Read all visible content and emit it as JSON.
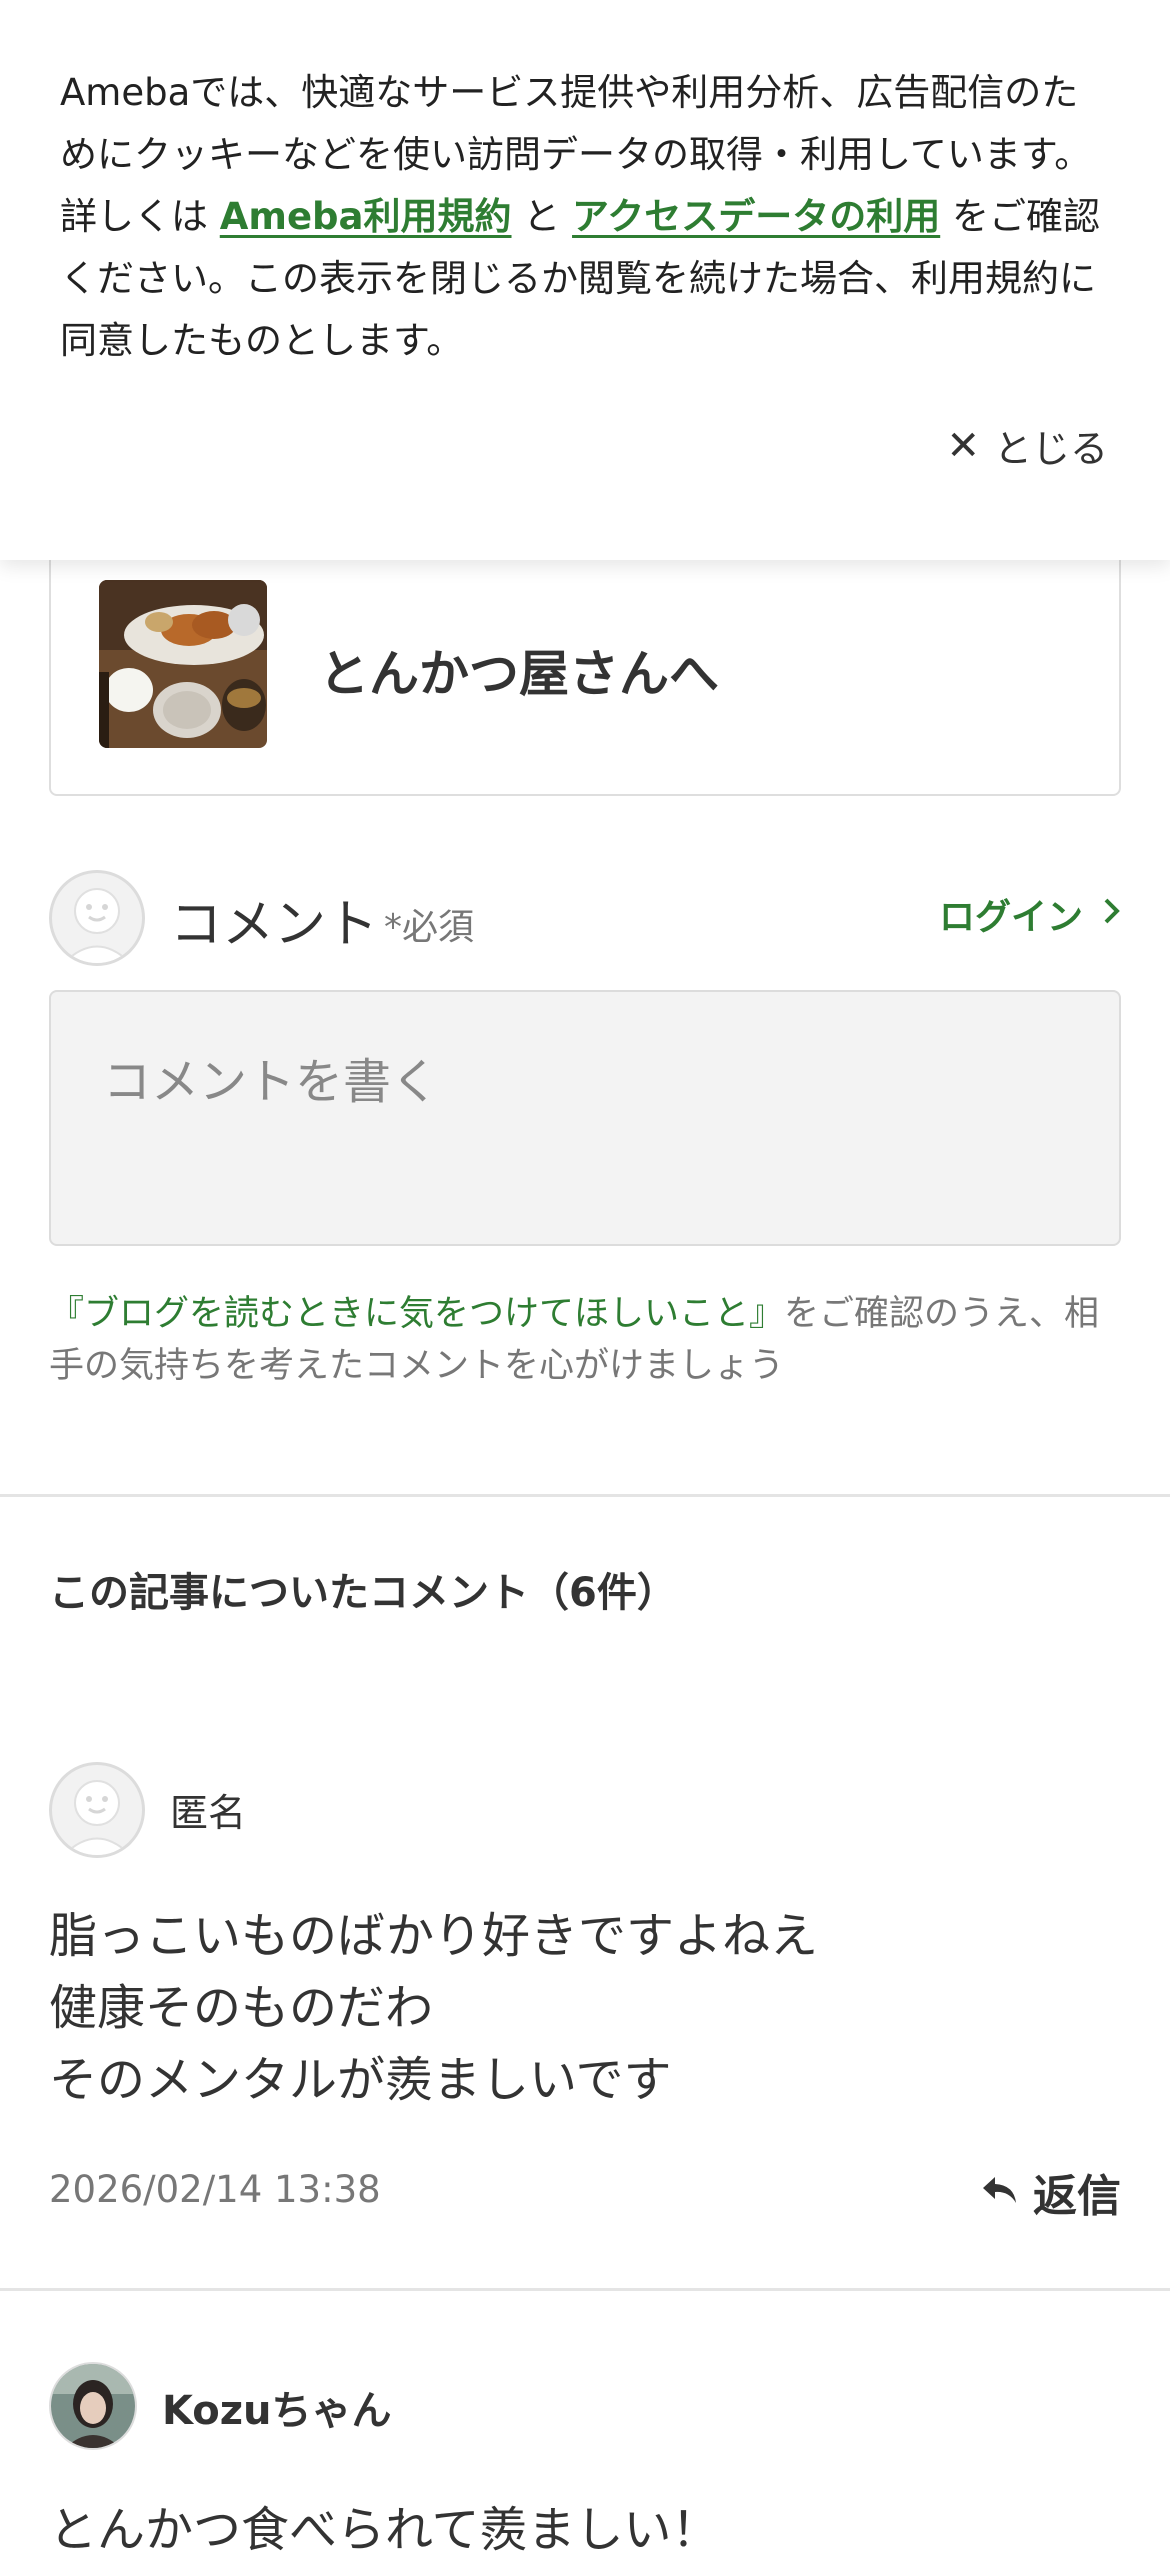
{
  "cookie_banner": {
    "text_before": "Amebaでは、快適なサービス提供や利用分析、広告配信のためにクッキーなどを使い訪問データの取得・利用しています。詳しくは ",
    "terms_link": "Ameba利用規約",
    "text_and": " と ",
    "access_link": "アクセスデータの利用",
    "text_after": " をご確認ください。この表示を閉じるか閲覧を続けた場合、利用規約に同意したものとします。",
    "close_label": "とじる"
  },
  "article": {
    "title": "とんかつ屋さんへ"
  },
  "comment_form": {
    "label": "コメント",
    "required": "*必須",
    "login_label": "ログイン",
    "placeholder": "コメントを書く",
    "guideline_link": "『ブログを読むときに気をつけてほしいこと』",
    "guideline_text": "をご確認のうえ、相手の気持ちを考えたコメントを心がけましょう"
  },
  "comments_section": {
    "heading": "この記事についたコメント（6件）",
    "reply_label": "返信",
    "comments": [
      {
        "author": "匿名",
        "lines": [
          "脂っこいものばかり好きですよねえ",
          "健康そのものだわ",
          "そのメンタルが羨ましいです"
        ],
        "date": "2026/02/14 13:38"
      },
      {
        "author": "Kozuちゃん",
        "text": "とんかつ食べられて羨ましい！"
      }
    ]
  },
  "colors": {
    "accent_green": "#2e7d32",
    "muted_text": "#777777",
    "border": "#dcdcdc"
  }
}
